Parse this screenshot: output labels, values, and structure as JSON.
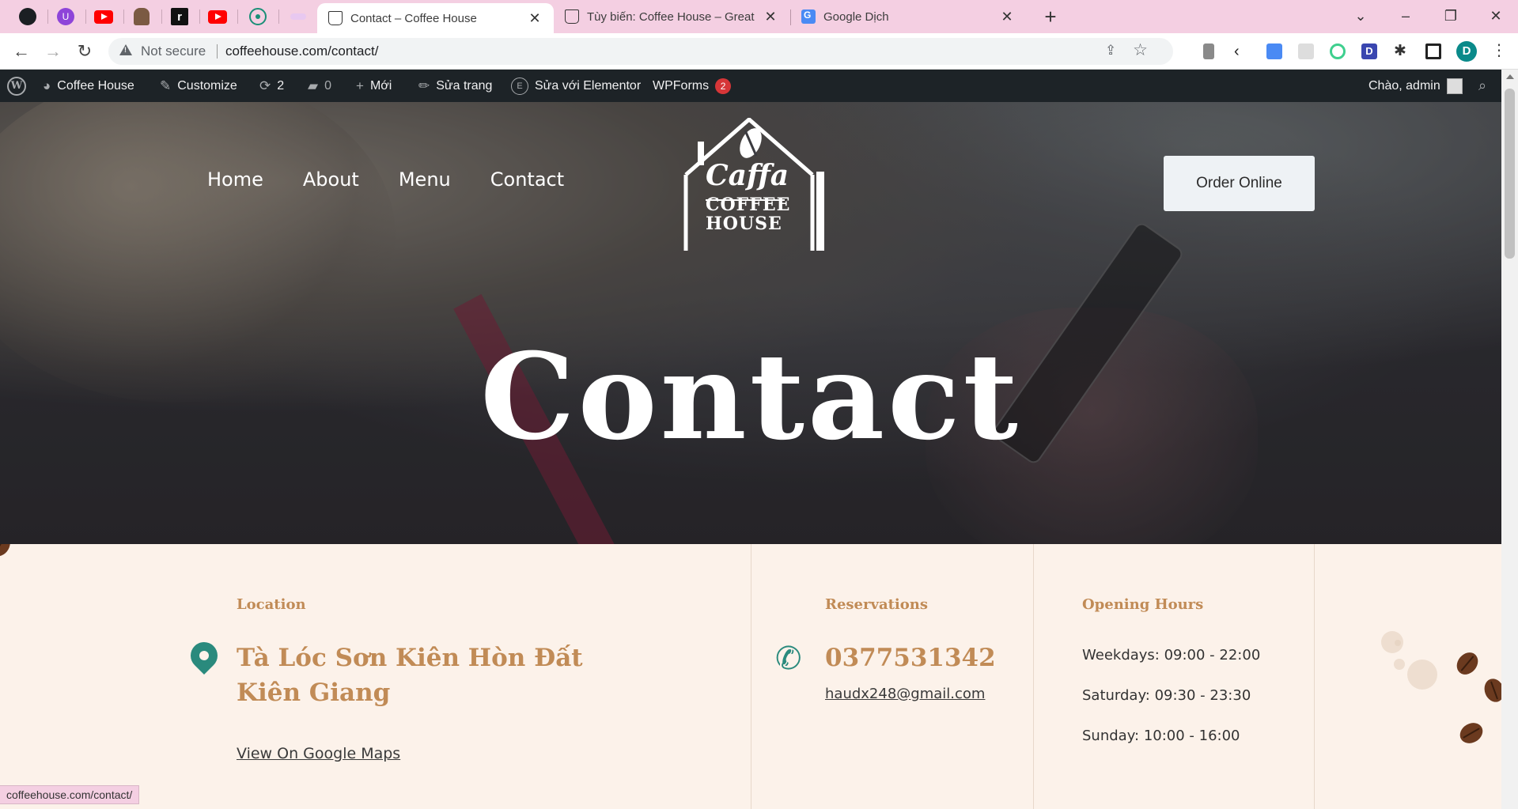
{
  "browser": {
    "tabs": [
      {
        "title": "Contact – Coffee House",
        "active": true
      },
      {
        "title": "Tùy biến: Coffee House – Great T",
        "active": false
      },
      {
        "title": "Google Dịch",
        "active": false
      }
    ],
    "pinned_icons": [
      "github-icon",
      "purple-u-icon",
      "youtube-icon",
      "figure-icon",
      "r-icon",
      "youtube-icon",
      "react-icon",
      "blank-icon"
    ],
    "security_label": "Not secure",
    "url": "coffeehouse.com/contact/",
    "profile_initial": "D",
    "status_url": "coffeehouse.com/contact/"
  },
  "adminbar": {
    "site_name": "Coffee House",
    "customize": "Customize",
    "updates_count": "2",
    "comments_count": "0",
    "new_label": "Mới",
    "edit_page": "Sửa trang",
    "edit_elementor": "Sửa với Elementor",
    "wpforms": "WPForms",
    "wpforms_badge": "2",
    "greeting": "Chào, admin"
  },
  "nav": {
    "items": [
      {
        "label": "Home"
      },
      {
        "label": "About"
      },
      {
        "label": "Menu"
      },
      {
        "label": "Contact"
      }
    ],
    "order_button": "Order Online"
  },
  "logo": {
    "script": "Caffa",
    "line1": "COFFEE",
    "line2": "HOUSE"
  },
  "hero": {
    "title": "Contact"
  },
  "info": {
    "location": {
      "label": "Location",
      "address_line1": "Tà Lóc Sơn Kiên Hòn Đất",
      "address_line2": "Kiên Giang",
      "map_link": "View On Google Maps"
    },
    "reservations": {
      "label": "Reservations",
      "phone": "0377531342",
      "email": "haudx248@gmail.com"
    },
    "hours": {
      "label": "Opening Hours",
      "weekdays": "Weekdays: 09:00 - 22:00",
      "saturday": "Saturday: 09:30 - 23:30",
      "sunday": "Sunday: 10:00 - 16:00"
    }
  },
  "colors": {
    "accent": "#c18b56",
    "icon_teal": "#2a8a7d",
    "admin_bar": "#1d2327",
    "tab_strip": "#f4cfe2",
    "info_bg": "#fcf2ea"
  }
}
